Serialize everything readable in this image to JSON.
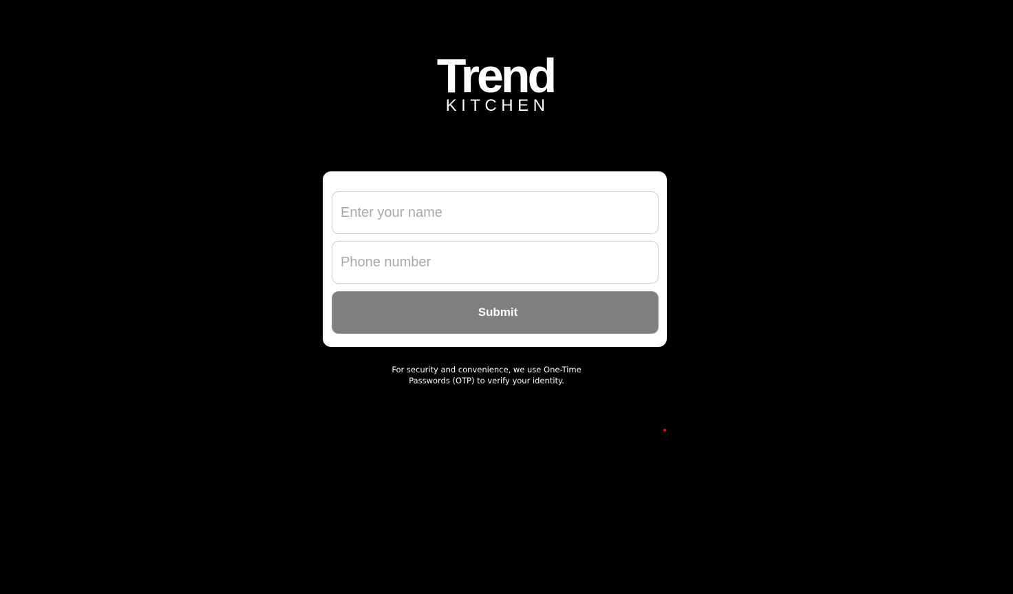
{
  "brand": {
    "name": "Trend",
    "subtitle": "KITCHEN"
  },
  "form": {
    "name_placeholder": "Enter your name",
    "name_value": "",
    "phone_placeholder": "Phone number",
    "phone_value": "",
    "submit_label": "Submit"
  },
  "footer": {
    "note": "For security and convenience, we use One-Time Passwords (OTP) to verify your identity."
  },
  "colors": {
    "background": "#000000",
    "card": "#ffffff",
    "submit_disabled": "#808080",
    "indicator_dot": "#e01010"
  }
}
